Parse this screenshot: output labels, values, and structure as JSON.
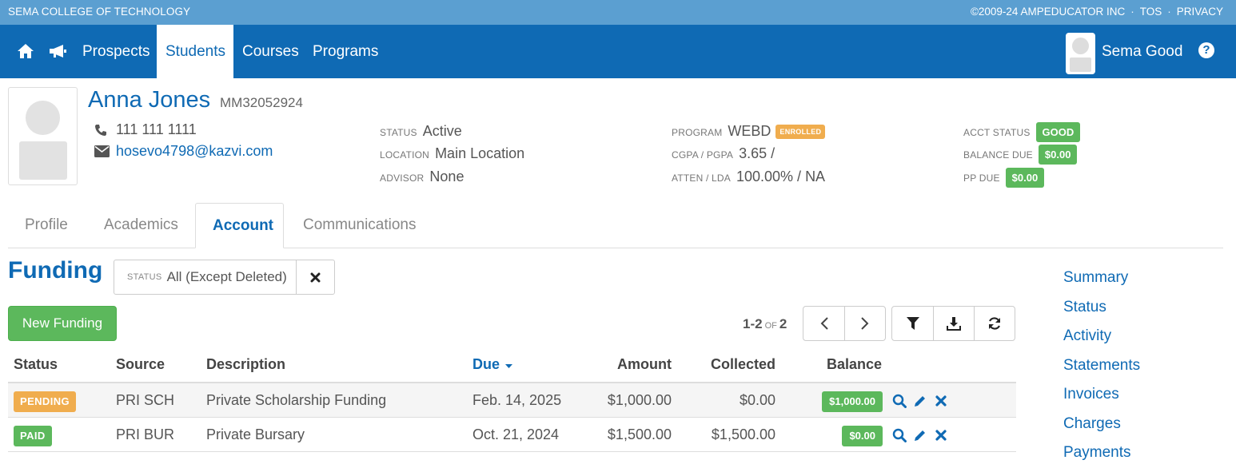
{
  "topbar": {
    "school_name": "SEMA COLLEGE OF TECHNOLOGY",
    "copyright": "©2009-24 AMPEDUCATOR INC",
    "separator": "·",
    "tos": "TOS",
    "privacy": "PRIVACY",
    "bg_color": "#5b9fd1"
  },
  "nav": {
    "home_icon": "home-icon",
    "announce_icon": "megaphone-icon",
    "items": [
      {
        "label": "Prospects",
        "active": false
      },
      {
        "label": "Students",
        "active": true
      },
      {
        "label": "Courses",
        "active": false
      },
      {
        "label": "Programs",
        "active": false
      }
    ],
    "user_name": "Sema Good",
    "help_icon": "question-circle-icon",
    "bg_color": "#0f6ab4"
  },
  "student": {
    "name": "Anna Jones",
    "id": "MM32052924",
    "phone": "111 111 1111",
    "email": "hosevo4798@kazvi.com",
    "status_label": "STATUS",
    "status_value": "Active",
    "location_label": "LOCATION",
    "location_value": "Main Location",
    "advisor_label": "ADVISOR",
    "advisor_value": "None",
    "program_label": "PROGRAM",
    "program_value": "WEBD",
    "program_badge": "ENROLLED",
    "cgpa_label": "CGPA / PGPA",
    "cgpa_value": "3.65 /",
    "atten_label": "ATTEN / LDA",
    "atten_value": "100.00% / NA",
    "acct_status_label": "ACCT STATUS",
    "acct_status_value": "GOOD",
    "balance_due_label": "BALANCE DUE",
    "balance_due_value": "$0.00",
    "pp_due_label": "PP DUE",
    "pp_due_value": "$0.00"
  },
  "tabs": [
    {
      "label": "Profile",
      "active": false
    },
    {
      "label": "Academics",
      "active": false
    },
    {
      "label": "Account",
      "active": true
    },
    {
      "label": "Communications",
      "active": false
    }
  ],
  "funding": {
    "title": "Funding",
    "filter_label": "STATUS",
    "filter_value": "All (Except Deleted)",
    "new_button": "New Funding",
    "pager_range": "1-2",
    "pager_of": "OF",
    "pager_total": "2",
    "columns": {
      "status": "Status",
      "source": "Source",
      "description": "Description",
      "due": "Due",
      "amount": "Amount",
      "collected": "Collected",
      "balance": "Balance"
    },
    "rows": [
      {
        "status": "PENDING",
        "status_color": "#f0ad4e",
        "source": "PRI SCH",
        "description": "Private Scholarship Funding",
        "due": "Feb. 14, 2025",
        "amount": "$1,000.00",
        "collected": "$0.00",
        "balance": "$1,000.00"
      },
      {
        "status": "PAID",
        "status_color": "#5cb85c",
        "source": "PRI BUR",
        "description": "Private Bursary",
        "due": "Oct. 21, 2024",
        "amount": "$1,500.00",
        "collected": "$1,500.00",
        "balance": "$0.00"
      }
    ]
  },
  "side_nav": [
    "Summary",
    "Status",
    "Activity",
    "Statements",
    "Invoices",
    "Charges",
    "Payments"
  ]
}
